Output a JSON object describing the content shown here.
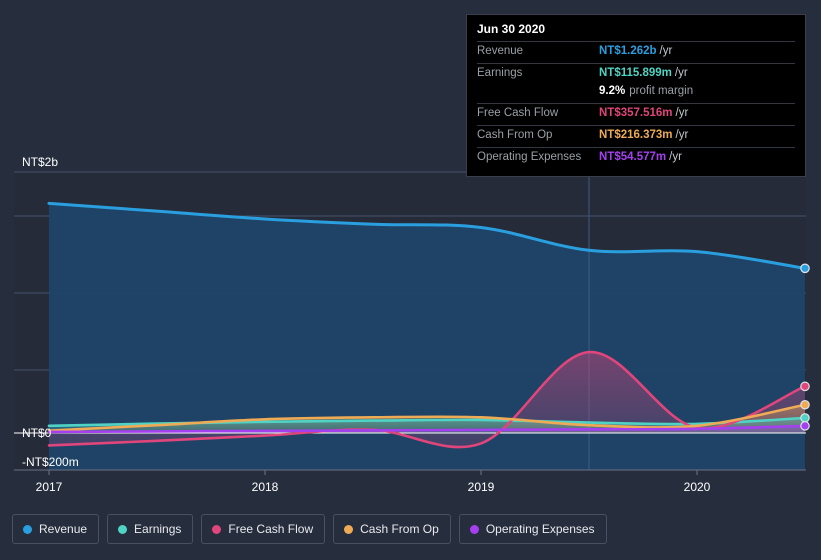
{
  "chart_data": {
    "type": "area",
    "title": "",
    "xlabel": "",
    "ylabel": "",
    "currency": "NT$",
    "grid": true,
    "legend_position": "bottom",
    "y_axis": {
      "top_label": "NT$2b",
      "zero_label": "NT$0",
      "bottom_label": "-NT$200m",
      "ylim": [
        -200000000,
        2000000000
      ],
      "tick_labels": [
        "NT$2b",
        "NT$0",
        "-NT$200m"
      ]
    },
    "x_axis": {
      "tick_labels": [
        "2017",
        "2018",
        "2019",
        "2020"
      ],
      "xlim": [
        "2016-07",
        "2020-09"
      ]
    },
    "x": [
      "2016-12",
      "2017-06",
      "2017-12",
      "2018-06",
      "2018-12",
      "2019-06",
      "2019-12",
      "2020-06"
    ],
    "series": [
      {
        "name": "Revenue",
        "color": "#2a9fe0",
        "values": [
          1760000000,
          1700000000,
          1640000000,
          1600000000,
          1575000000,
          1400000000,
          1390000000,
          1262000000
        ],
        "end_value_label": "NT$1.262b"
      },
      {
        "name": "Earnings",
        "color": "#4fd3c4",
        "values": [
          55000000,
          72000000,
          86000000,
          95000000,
          100000000,
          80000000,
          70000000,
          115899000
        ],
        "end_value_label": "NT$115.899m"
      },
      {
        "name": "Free Cash Flow",
        "color": "#e0457b",
        "values": [
          -95000000,
          -60000000,
          -20000000,
          25000000,
          -80000000,
          620000000,
          40000000,
          357516000
        ],
        "end_value_label": "NT$357.516m"
      },
      {
        "name": "Cash From Op",
        "color": "#eeaa55",
        "values": [
          18000000,
          60000000,
          105000000,
          120000000,
          120000000,
          60000000,
          55000000,
          216373000
        ],
        "end_value_label": "NT$216.373m"
      },
      {
        "name": "Operating Expenses",
        "color": "#a540f0",
        "values": [
          8000000,
          12000000,
          16000000,
          20000000,
          24000000,
          28000000,
          32000000,
          54577000
        ],
        "end_value_label": "NT$54.577m"
      }
    ]
  },
  "tooltip": {
    "title": "Jun 30 2020",
    "unit_suffix": "/yr",
    "rows": [
      {
        "label": "Revenue",
        "value": "NT$1.262b",
        "unit": "/yr",
        "color": "#2a9fe0"
      },
      {
        "label": "Earnings",
        "value": "NT$115.899m",
        "unit": "/yr",
        "color": "#4fd3c4"
      },
      {
        "label": "",
        "value": "9.2%",
        "note": "profit margin",
        "color": "#ffffff"
      },
      {
        "label": "Free Cash Flow",
        "value": "NT$357.516m",
        "unit": "/yr",
        "color": "#e0457b"
      },
      {
        "label": "Cash From Op",
        "value": "NT$216.373m",
        "unit": "/yr",
        "color": "#eeaa55"
      },
      {
        "label": "Operating Expenses",
        "value": "NT$54.577m",
        "unit": "/yr",
        "color": "#a540f0"
      }
    ]
  },
  "legend": {
    "items": [
      {
        "label": "Revenue",
        "color": "#2a9fe0"
      },
      {
        "label": "Earnings",
        "color": "#4fd3c4"
      },
      {
        "label": "Free Cash Flow",
        "color": "#e0457b"
      },
      {
        "label": "Cash From Op",
        "color": "#eeaa55"
      },
      {
        "label": "Operating Expenses",
        "color": "#a540f0"
      }
    ]
  },
  "marker_line": {
    "x_label": "Jun 30 2020",
    "color": "#3d5d86"
  }
}
